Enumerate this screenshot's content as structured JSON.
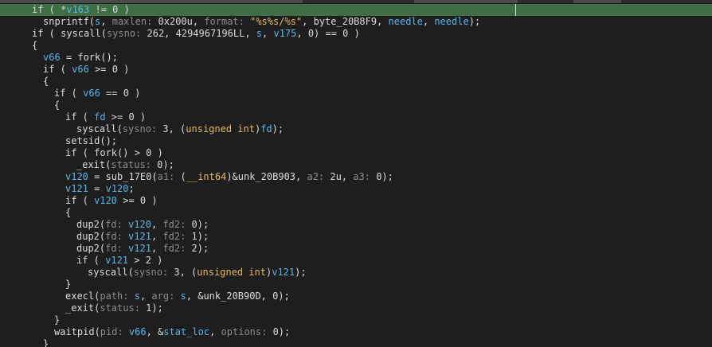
{
  "colors": {
    "background": "#1e1e1e",
    "highlight_line": "#3f6d44",
    "default_text": "#dcdcdc",
    "variable": "#58b6ec",
    "param_hint": "#8c8c8c",
    "string_literal": "#e5b95c",
    "type_keyword": "#e5b95c"
  },
  "code_lines": [
    {
      "indent": 2,
      "highlight": true,
      "tokens": [
        {
          "t": "if ( *",
          "k": "plain"
        },
        {
          "t": "v163",
          "k": "var"
        },
        {
          "t": " != 0 )",
          "k": "plain"
        }
      ]
    },
    {
      "indent": 3,
      "tokens": [
        {
          "t": "snprintf(",
          "k": "fn"
        },
        {
          "t": "s",
          "k": "var"
        },
        {
          "t": ", ",
          "k": "plain"
        },
        {
          "t": "maxlen: ",
          "k": "param"
        },
        {
          "t": "0x200u, ",
          "k": "plain"
        },
        {
          "t": "format: ",
          "k": "param"
        },
        {
          "t": "\"%s%s/%s\"",
          "k": "str"
        },
        {
          "t": ", byte_20B8F9, ",
          "k": "plain"
        },
        {
          "t": "needle",
          "k": "var"
        },
        {
          "t": ", ",
          "k": "plain"
        },
        {
          "t": "needle",
          "k": "var"
        },
        {
          "t": ");",
          "k": "plain"
        }
      ]
    },
    {
      "indent": 2,
      "tokens": [
        {
          "t": "if ( syscall(",
          "k": "plain"
        },
        {
          "t": "sysno: ",
          "k": "param"
        },
        {
          "t": "262, 4294967196LL, ",
          "k": "plain"
        },
        {
          "t": "s",
          "k": "var"
        },
        {
          "t": ", ",
          "k": "plain"
        },
        {
          "t": "v175",
          "k": "var"
        },
        {
          "t": ", 0) == 0 )",
          "k": "plain"
        }
      ]
    },
    {
      "indent": 2,
      "tokens": [
        {
          "t": "{",
          "k": "plain"
        }
      ]
    },
    {
      "indent": 3,
      "tokens": [
        {
          "t": "v66",
          "k": "var"
        },
        {
          "t": " = fork();",
          "k": "plain"
        }
      ]
    },
    {
      "indent": 3,
      "tokens": [
        {
          "t": "if ( ",
          "k": "plain"
        },
        {
          "t": "v66",
          "k": "var"
        },
        {
          "t": " >= 0 )",
          "k": "plain"
        }
      ]
    },
    {
      "indent": 3,
      "tokens": [
        {
          "t": "{",
          "k": "plain"
        }
      ]
    },
    {
      "indent": 4,
      "tokens": [
        {
          "t": "if ( ",
          "k": "plain"
        },
        {
          "t": "v66",
          "k": "var"
        },
        {
          "t": " == 0 )",
          "k": "plain"
        }
      ]
    },
    {
      "indent": 4,
      "tokens": [
        {
          "t": "{",
          "k": "plain"
        }
      ]
    },
    {
      "indent": 5,
      "tokens": [
        {
          "t": "if ( ",
          "k": "plain"
        },
        {
          "t": "fd",
          "k": "var"
        },
        {
          "t": " >= 0 )",
          "k": "plain"
        }
      ]
    },
    {
      "indent": 6,
      "tokens": [
        {
          "t": "syscall(",
          "k": "plain"
        },
        {
          "t": "sysno: ",
          "k": "param"
        },
        {
          "t": "3, (",
          "k": "plain"
        },
        {
          "t": "unsigned int",
          "k": "type"
        },
        {
          "t": ")",
          "k": "plain"
        },
        {
          "t": "fd",
          "k": "var"
        },
        {
          "t": ");",
          "k": "plain"
        }
      ]
    },
    {
      "indent": 5,
      "tokens": [
        {
          "t": "setsid();",
          "k": "plain"
        }
      ]
    },
    {
      "indent": 5,
      "tokens": [
        {
          "t": "if ( fork() > 0 )",
          "k": "plain"
        }
      ]
    },
    {
      "indent": 6,
      "tokens": [
        {
          "t": "_exit(",
          "k": "plain"
        },
        {
          "t": "status: ",
          "k": "param"
        },
        {
          "t": "0);",
          "k": "plain"
        }
      ]
    },
    {
      "indent": 5,
      "tokens": [
        {
          "t": "v120",
          "k": "var"
        },
        {
          "t": " = sub_17E0(",
          "k": "plain"
        },
        {
          "t": "a1: ",
          "k": "param"
        },
        {
          "t": "(",
          "k": "plain"
        },
        {
          "t": "__int64",
          "k": "type"
        },
        {
          "t": ")&unk_20B903, ",
          "k": "plain"
        },
        {
          "t": "a2: ",
          "k": "param"
        },
        {
          "t": "2u, ",
          "k": "plain"
        },
        {
          "t": "a3: ",
          "k": "param"
        },
        {
          "t": "0);",
          "k": "plain"
        }
      ]
    },
    {
      "indent": 5,
      "tokens": [
        {
          "t": "v121",
          "k": "var"
        },
        {
          "t": " = ",
          "k": "plain"
        },
        {
          "t": "v120",
          "k": "var"
        },
        {
          "t": ";",
          "k": "plain"
        }
      ]
    },
    {
      "indent": 5,
      "tokens": [
        {
          "t": "if ( ",
          "k": "plain"
        },
        {
          "t": "v120",
          "k": "var"
        },
        {
          "t": " >= 0 )",
          "k": "plain"
        }
      ]
    },
    {
      "indent": 5,
      "tokens": [
        {
          "t": "{",
          "k": "plain"
        }
      ]
    },
    {
      "indent": 6,
      "tokens": [
        {
          "t": "dup2(",
          "k": "plain"
        },
        {
          "t": "fd: ",
          "k": "param"
        },
        {
          "t": "v120",
          "k": "var"
        },
        {
          "t": ", ",
          "k": "plain"
        },
        {
          "t": "fd2: ",
          "k": "param"
        },
        {
          "t": "0);",
          "k": "plain"
        }
      ]
    },
    {
      "indent": 6,
      "tokens": [
        {
          "t": "dup2(",
          "k": "plain"
        },
        {
          "t": "fd: ",
          "k": "param"
        },
        {
          "t": "v121",
          "k": "var"
        },
        {
          "t": ", ",
          "k": "plain"
        },
        {
          "t": "fd2: ",
          "k": "param"
        },
        {
          "t": "1);",
          "k": "plain"
        }
      ]
    },
    {
      "indent": 6,
      "tokens": [
        {
          "t": "dup2(",
          "k": "plain"
        },
        {
          "t": "fd: ",
          "k": "param"
        },
        {
          "t": "v121",
          "k": "var"
        },
        {
          "t": ", ",
          "k": "plain"
        },
        {
          "t": "fd2: ",
          "k": "param"
        },
        {
          "t": "2);",
          "k": "plain"
        }
      ]
    },
    {
      "indent": 6,
      "tokens": [
        {
          "t": "if ( ",
          "k": "plain"
        },
        {
          "t": "v121",
          "k": "var"
        },
        {
          "t": " > 2 )",
          "k": "plain"
        }
      ]
    },
    {
      "indent": 7,
      "tokens": [
        {
          "t": "syscall(",
          "k": "plain"
        },
        {
          "t": "sysno: ",
          "k": "param"
        },
        {
          "t": "3, (",
          "k": "plain"
        },
        {
          "t": "unsigned int",
          "k": "type"
        },
        {
          "t": ")",
          "k": "plain"
        },
        {
          "t": "v121",
          "k": "var"
        },
        {
          "t": ");",
          "k": "plain"
        }
      ]
    },
    {
      "indent": 5,
      "tokens": [
        {
          "t": "}",
          "k": "plain"
        }
      ]
    },
    {
      "indent": 5,
      "tokens": [
        {
          "t": "execl(",
          "k": "plain"
        },
        {
          "t": "path: ",
          "k": "param"
        },
        {
          "t": "s",
          "k": "var"
        },
        {
          "t": ", ",
          "k": "plain"
        },
        {
          "t": "arg: ",
          "k": "param"
        },
        {
          "t": "s",
          "k": "var"
        },
        {
          "t": ", &unk_20B90D, 0);",
          "k": "plain"
        }
      ]
    },
    {
      "indent": 5,
      "tokens": [
        {
          "t": "_exit(",
          "k": "plain"
        },
        {
          "t": "status: ",
          "k": "param"
        },
        {
          "t": "1);",
          "k": "plain"
        }
      ]
    },
    {
      "indent": 4,
      "tokens": [
        {
          "t": "}",
          "k": "plain"
        }
      ]
    },
    {
      "indent": 4,
      "tokens": [
        {
          "t": "waitpid(",
          "k": "plain"
        },
        {
          "t": "pid: ",
          "k": "param"
        },
        {
          "t": "v66",
          "k": "var"
        },
        {
          "t": ", &",
          "k": "plain"
        },
        {
          "t": "stat_loc",
          "k": "var"
        },
        {
          "t": ", ",
          "k": "plain"
        },
        {
          "t": "options: ",
          "k": "param"
        },
        {
          "t": "0);",
          "k": "plain"
        }
      ]
    },
    {
      "indent": 3,
      "tokens": [
        {
          "t": "}",
          "k": "plain"
        }
      ]
    }
  ]
}
